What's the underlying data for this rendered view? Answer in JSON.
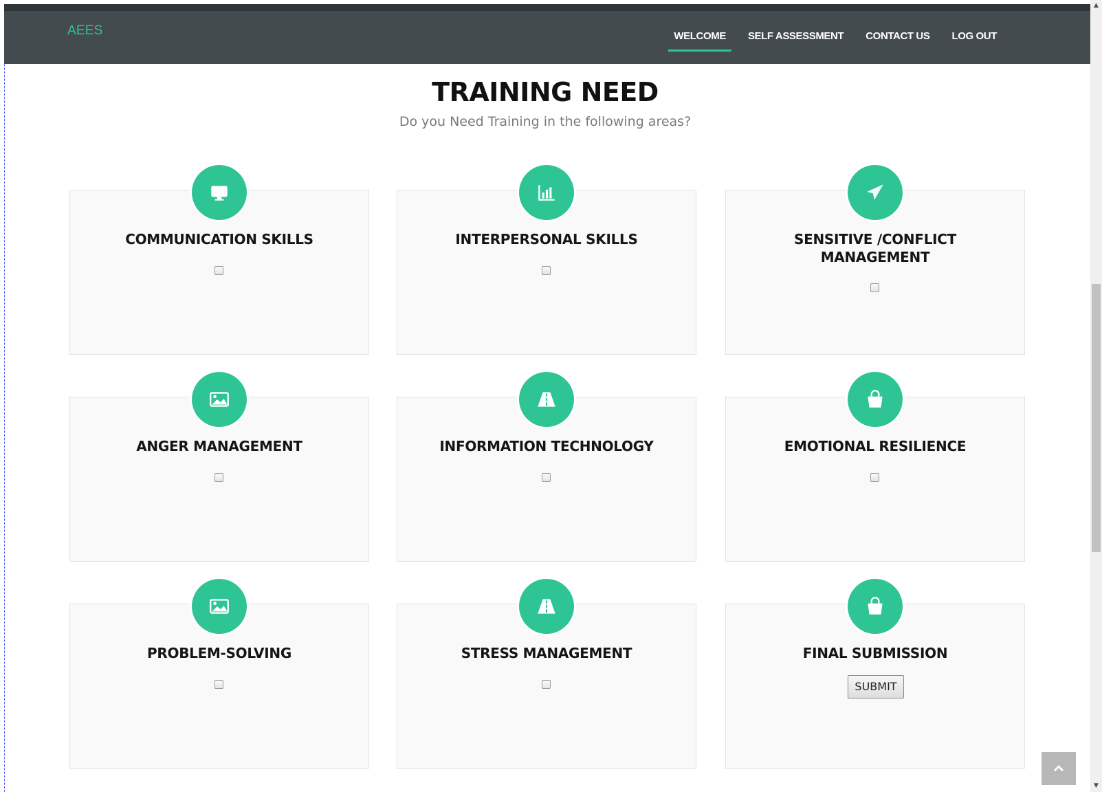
{
  "brand": "AEES",
  "nav": [
    {
      "label": "WELCOME",
      "active": true
    },
    {
      "label": "SELF ASSESSMENT",
      "active": false
    },
    {
      "label": "CONTACT US",
      "active": false
    },
    {
      "label": "LOG OUT",
      "active": false
    }
  ],
  "page": {
    "title": "TRAINING NEED",
    "subtitle": "Do you Need Training in the following areas?"
  },
  "cards": [
    {
      "title": "COMMUNICATION SKILLS",
      "icon": "monitor-icon",
      "checked": false
    },
    {
      "title": "INTERPERSONAL SKILLS",
      "icon": "bar-chart-icon",
      "checked": false
    },
    {
      "title": "SENSITIVE /CONFLICT MANAGEMENT",
      "icon": "paper-plane-icon",
      "checked": false
    },
    {
      "title": "ANGER MANAGEMENT",
      "icon": "image-icon",
      "checked": false
    },
    {
      "title": "INFORMATION TECHNOLOGY",
      "icon": "road-icon",
      "checked": false
    },
    {
      "title": "EMOTIONAL RESILIENCE",
      "icon": "shopping-bag-icon",
      "checked": false
    },
    {
      "title": "PROBLEM-SOLVING",
      "icon": "image-icon",
      "checked": false
    },
    {
      "title": "STRESS MANAGEMENT",
      "icon": "road-icon",
      "checked": false
    },
    {
      "title": "FINAL SUBMISSION",
      "icon": "shopping-bag-icon",
      "button_label": "SUBMIT"
    }
  ],
  "colors": {
    "accent": "#2ec493",
    "navbar": "#444b4f",
    "card_bg": "#f9f9f9"
  }
}
